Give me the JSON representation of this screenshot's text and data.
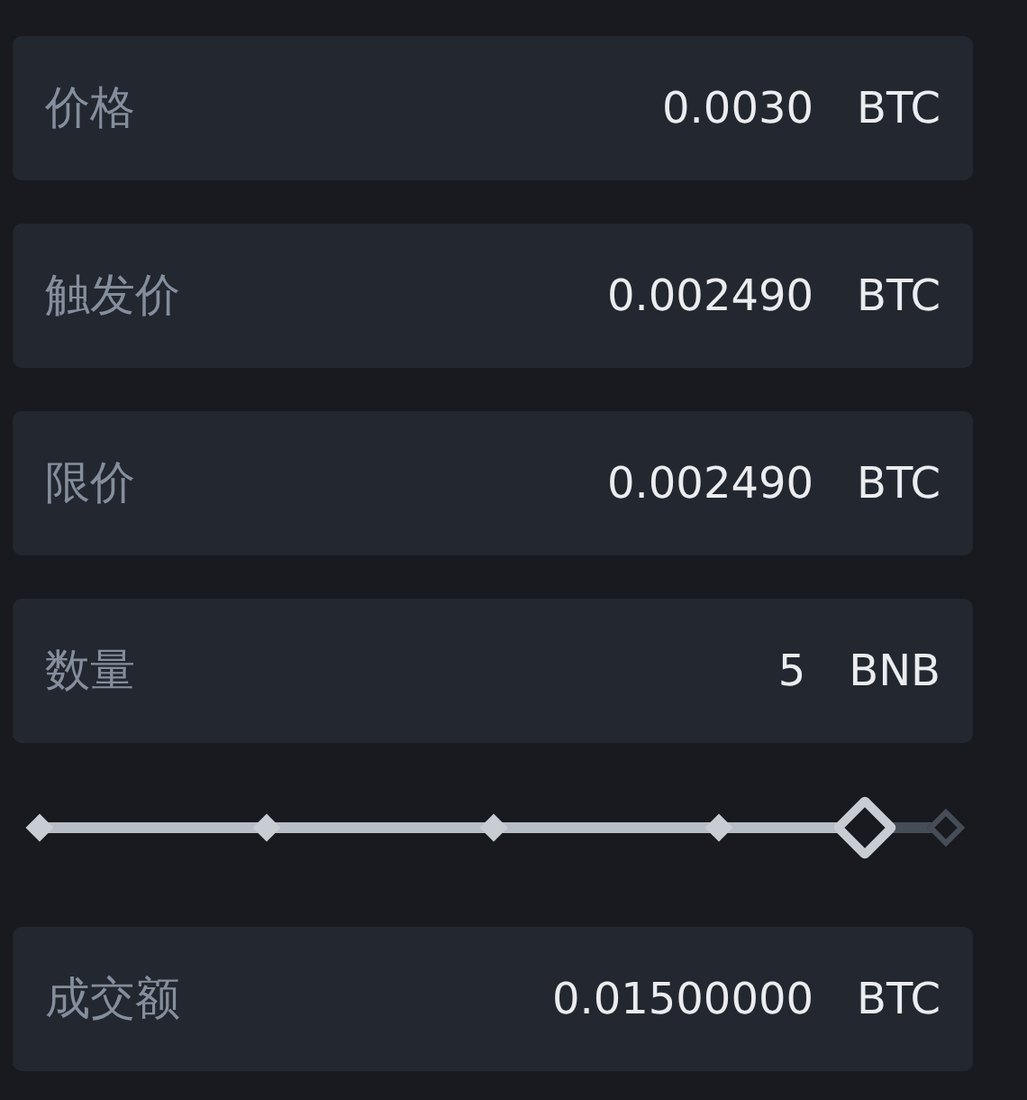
{
  "fields": [
    {
      "label": "价格",
      "value": "0.0030",
      "unit": "BTC"
    },
    {
      "label": "触发价",
      "value": "0.002490",
      "unit": "BTC"
    },
    {
      "label": "限价",
      "value": "0.002490",
      "unit": "BTC"
    },
    {
      "label": "数量",
      "value": "5",
      "unit": "BNB"
    }
  ],
  "slider": {
    "level": 0.91
  },
  "total": {
    "label": "成交额",
    "value": "0.01500000",
    "unit": "BTC"
  }
}
